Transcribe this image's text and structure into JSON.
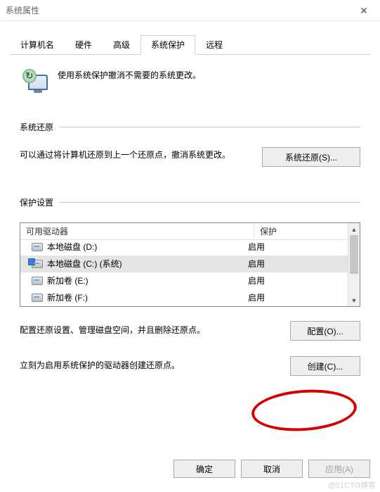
{
  "window": {
    "title": "系统属性"
  },
  "tabs": [
    {
      "label": "计算机名",
      "active": false
    },
    {
      "label": "硬件",
      "active": false
    },
    {
      "label": "高级",
      "active": false
    },
    {
      "label": "系统保护",
      "active": true
    },
    {
      "label": "远程",
      "active": false
    }
  ],
  "intro": {
    "text": "使用系统保护撤消不需要的系统更改。"
  },
  "restore": {
    "title": "系统还原",
    "desc": "可以通过将计算机还原到上一个还原点，撤消系统更改。",
    "button": "系统还原(S)..."
  },
  "settings": {
    "title": "保护设置",
    "columns": {
      "drive": "可用驱动器",
      "protection": "保护"
    },
    "rows": [
      {
        "name": "本地磁盘 (D:)",
        "protection": "启用",
        "system": false,
        "selected": false
      },
      {
        "name": "本地磁盘 (C:) (系统)",
        "protection": "启用",
        "system": true,
        "selected": true
      },
      {
        "name": "新加卷 (E:)",
        "protection": "启用",
        "system": false,
        "selected": false
      },
      {
        "name": "新加卷 (F:)",
        "protection": "启用",
        "system": false,
        "selected": false
      }
    ],
    "config_desc": "配置还原设置、管理磁盘空间，并且删除还原点。",
    "config_button": "配置(O)...",
    "create_desc": "立刻为启用系统保护的驱动器创建还原点。",
    "create_button": "创建(C)..."
  },
  "dialog_buttons": {
    "ok": "确定",
    "cancel": "取消",
    "apply": "应用(A)"
  },
  "watermark": "@51CTO博客"
}
